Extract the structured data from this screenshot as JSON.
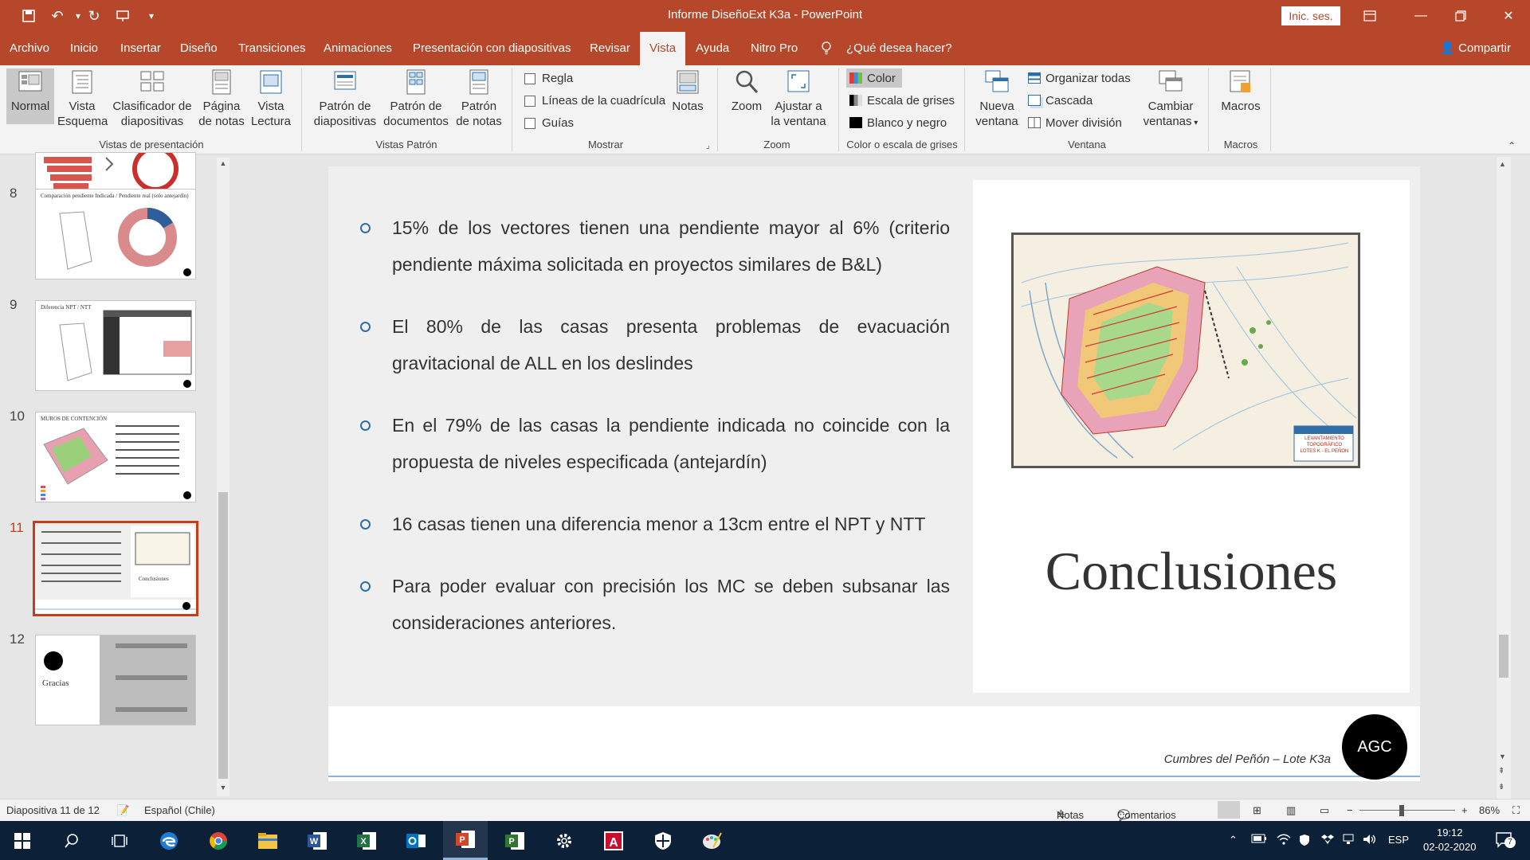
{
  "window": {
    "title": "Informe DiseñoExt K3a  -  PowerPoint",
    "signin_label": "Inic. ses."
  },
  "menu": {
    "tabs": [
      {
        "label": "Archivo"
      },
      {
        "label": "Inicio"
      },
      {
        "label": "Insertar"
      },
      {
        "label": "Diseño"
      },
      {
        "label": "Transiciones"
      },
      {
        "label": "Animaciones"
      },
      {
        "label": "Presentación con diapositivas"
      },
      {
        "label": "Revisar"
      },
      {
        "label": "Vista"
      },
      {
        "label": "Ayuda"
      },
      {
        "label": "Nitro Pro"
      },
      {
        "label": "¿Qué desea hacer?"
      }
    ],
    "share_label": "Compartir"
  },
  "ribbon": {
    "presentation_views": {
      "label": "Vistas de presentación",
      "normal": "Normal",
      "outline": [
        "Vista",
        "Esquema"
      ],
      "sorter": [
        "Clasificador de",
        "diapositivas"
      ],
      "notes_page": [
        "Página",
        "de notas"
      ],
      "reading": [
        "Vista",
        "Lectura"
      ]
    },
    "master_views": {
      "label": "Vistas Patrón",
      "slide_master": [
        "Patrón de",
        "diapositivas"
      ],
      "handout_master": [
        "Patrón de",
        "documentos"
      ],
      "notes_master": [
        "Patrón",
        "de notas"
      ]
    },
    "show": {
      "label": "Mostrar",
      "ruler": "Regla",
      "gridlines": "Líneas de la cuadrícula",
      "guides": "Guías",
      "notes": "Notas"
    },
    "zoom": {
      "label": "Zoom",
      "zoom": "Zoom",
      "fit": [
        "Ajustar a",
        "la ventana"
      ]
    },
    "color": {
      "label": "Color o escala de grises",
      "color": "Color",
      "grayscale": "Escala de grises",
      "bw": "Blanco y negro"
    },
    "window": {
      "label": "Ventana",
      "new_window": [
        "Nueva",
        "ventana"
      ],
      "arrange_all": "Organizar todas",
      "cascade": "Cascada",
      "move_split": "Mover división",
      "switch": [
        "Cambiar",
        "ventanas"
      ]
    },
    "macros": {
      "label": "Macros",
      "macros": "Macros"
    }
  },
  "thumbnails": [
    {
      "number": "",
      "title": ""
    },
    {
      "number": "8",
      "title": "Comparación pendiente Indicada / Pendiente real (solo antejardín)"
    },
    {
      "number": "9",
      "title": "Diferencia NPT / NTT"
    },
    {
      "number": "10",
      "title": "MUROS DE CONTENCIÓN"
    },
    {
      "number": "11",
      "title": "Conclusiones"
    },
    {
      "number": "12",
      "title": "Gracias"
    }
  ],
  "slide": {
    "bullets": [
      "15% de los vectores tienen una pendiente mayor al 6% (criterio pendiente máxima solicitada en proyectos similares de B&L)",
      "El 80% de las casas presenta problemas de evacuación gravitacional de ALL en los deslindes",
      "En el 79% de las casas la pendiente indicada no coincide con la propuesta de niveles especificada (antejardín)",
      "16 casas tienen una diferencia menor a 13cm entre el NPT y NTT",
      "Para poder evaluar con precisión los MC se deben subsanar las consideraciones anteriores."
    ],
    "title": "Conclusiones",
    "footer": "Cumbres del Peñón – Lote K3a",
    "logo_text": "AGC",
    "image_caption": [
      "LEVANTAMIENTO TOPOGRÁFICO",
      "LOTES K - EL PEÑON"
    ]
  },
  "status": {
    "slide_info": "Diapositiva 11 de 12",
    "language": "Español (Chile)",
    "notes": "Notas",
    "comments": "Comentarios",
    "zoom": "86%"
  },
  "taskbar": {
    "language": "ESP",
    "time": "19:12",
    "date": "02-02-2020",
    "notifications": "7"
  }
}
